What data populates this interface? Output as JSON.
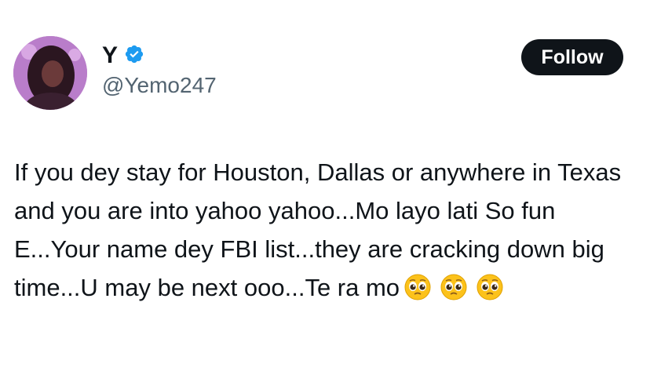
{
  "user": {
    "display_name": "Y",
    "handle": "@Yemo247",
    "verified_icon": "verified-badge-icon",
    "verified_color": "#1d9bf0"
  },
  "follow_button": {
    "label": "Follow"
  },
  "tweet": {
    "text": "If you dey stay for Houston, Dallas or anywhere in Texas and you are into yahoo yahoo...Mo layo lati So fun E...Your name dey FBI list...they are cracking down big time...U may be next ooo...Te ra mo",
    "emojis": [
      "pleading-face-emoji",
      "pleading-face-emoji",
      "pleading-face-emoji"
    ]
  },
  "colors": {
    "text": "#0f1419",
    "secondary": "#536471",
    "button_bg": "#0f1419"
  }
}
